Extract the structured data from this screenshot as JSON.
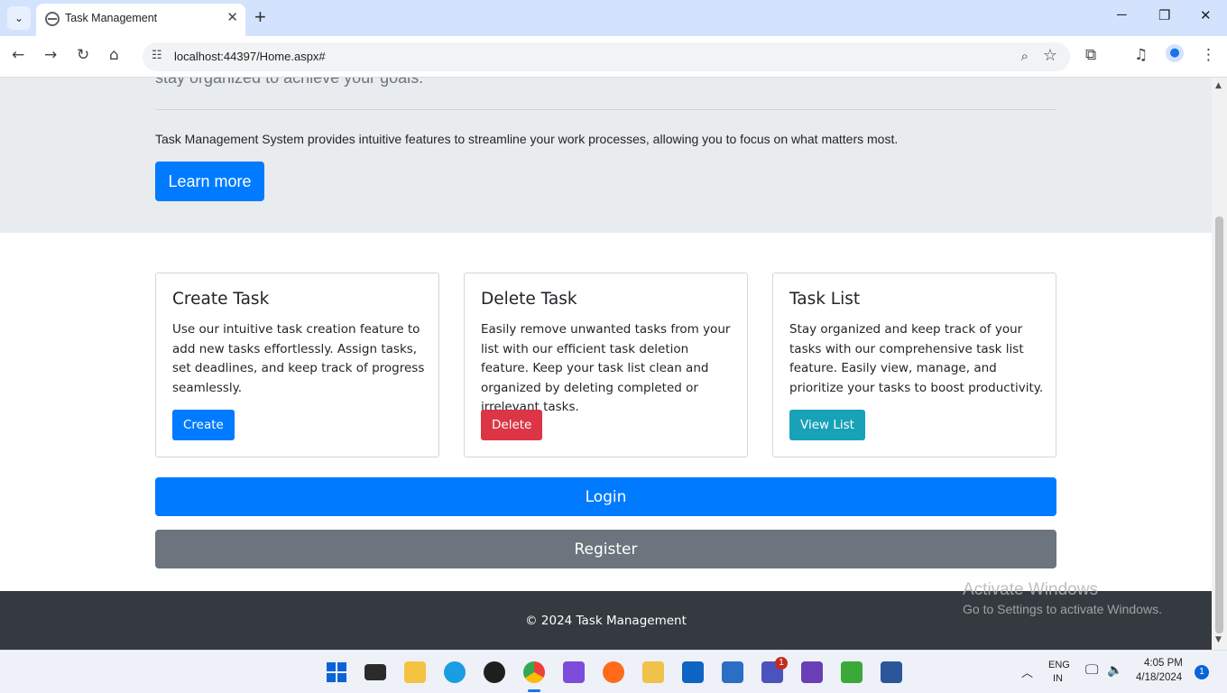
{
  "browser": {
    "tab_title": "Task Management",
    "tab_close": "✕",
    "new_tab": "+",
    "url": "localhost:44397/Home.aspx#",
    "window_controls": {
      "minimize": "─",
      "restore": "❐",
      "close": "✕"
    }
  },
  "jumbotron": {
    "lead_partial": "stay organized to achieve your goals.",
    "text": "Task Management System provides intuitive features to streamline your work processes, allowing you to focus on what matters most.",
    "button": "Learn more"
  },
  "cards": [
    {
      "title": "Create Task",
      "text": "Use our intuitive task creation feature to add new tasks effortlessly. Assign tasks, set deadlines, and keep track of progress seamlessly.",
      "button": "Create",
      "color": "#007bff"
    },
    {
      "title": "Delete Task",
      "text": "Easily remove unwanted tasks from your list with our efficient task deletion feature. Keep your task list clean and organized by deleting completed or irrelevant tasks.",
      "button": "Delete",
      "color": "#dc3545"
    },
    {
      "title": "Task List",
      "text": "Stay organized and keep track of your tasks with our comprehensive task list feature. Easily view, manage, and prioritize your tasks to boost productivity.",
      "button": "View List",
      "color": "#17a2b8"
    }
  ],
  "login_button": "Login",
  "register_button": "Register",
  "footer": "© 2024 Task Management",
  "watermark": {
    "line1": "Activate Windows",
    "line2": "Go to Settings to activate Windows."
  },
  "taskbar": {
    "lang1": "ENG",
    "lang2": "IN",
    "time": "4:05 PM",
    "date": "4/18/2024",
    "notification_count": "1",
    "teams_badge": "1"
  },
  "colors": {
    "primary": "#007bff",
    "danger": "#dc3545",
    "info": "#17a2b8",
    "secondary": "#6c757d",
    "footer_bg": "#343a40",
    "jumbotron_bg": "#e9ecef"
  }
}
